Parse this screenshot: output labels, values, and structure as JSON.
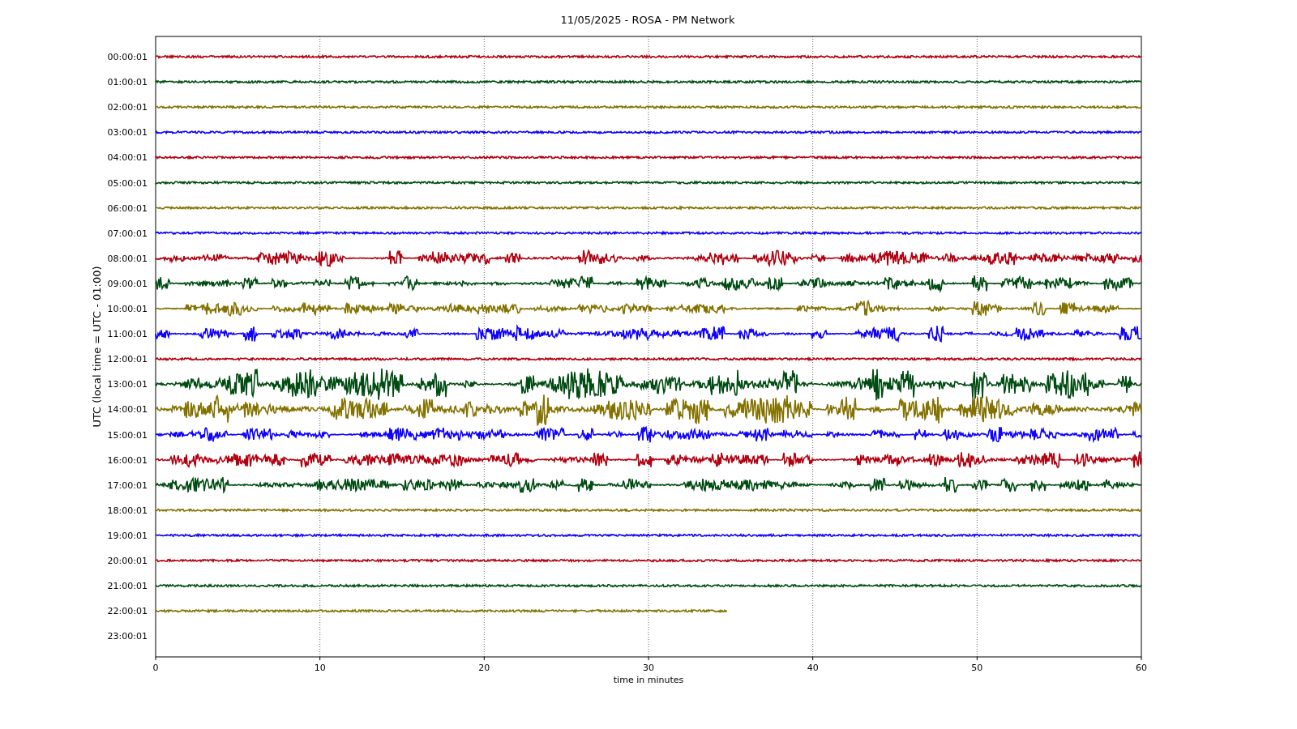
{
  "title": "11/05/2025 - ROSA - PM Network",
  "ylabel": "UTC (local time = UTC - 01:00)",
  "xlabel": "time in minutes",
  "xticks": [
    "0",
    "10",
    "20",
    "30",
    "40",
    "50",
    "60"
  ],
  "rows": [
    {
      "label": "00:00:01",
      "color": "#b2000f",
      "kind": "quiet",
      "level": 1
    },
    {
      "label": "01:00:01",
      "color": "#004c12",
      "kind": "quiet",
      "level": 1
    },
    {
      "label": "02:00:01",
      "color": "#847200",
      "kind": "quiet",
      "level": 1
    },
    {
      "label": "03:00:01",
      "color": "#0e01ff",
      "kind": "quiet",
      "level": 1
    },
    {
      "label": "04:00:01",
      "color": "#b2000f",
      "kind": "quiet",
      "level": 1
    },
    {
      "label": "05:00:01",
      "color": "#004c12",
      "kind": "quiet",
      "level": 1
    },
    {
      "label": "06:00:01",
      "color": "#847200",
      "kind": "quiet",
      "level": 1
    },
    {
      "label": "07:00:01",
      "color": "#0e01ff",
      "kind": "quiet",
      "level": 1
    },
    {
      "label": "08:00:01",
      "color": "#b2000f",
      "kind": "noisy",
      "level": 1
    },
    {
      "label": "09:00:01",
      "color": "#004c12",
      "kind": "noisy",
      "level": 1
    },
    {
      "label": "10:00:01",
      "color": "#847200",
      "kind": "noisy",
      "level": 1
    },
    {
      "label": "11:00:01",
      "color": "#0e01ff",
      "kind": "noisy",
      "level": 1
    },
    {
      "label": "12:00:01",
      "color": "#b2000f",
      "kind": "quiet",
      "level": 1
    },
    {
      "label": "13:00:01",
      "color": "#004c12",
      "kind": "strong",
      "level": 1
    },
    {
      "label": "14:00:01",
      "color": "#847200",
      "kind": "strong",
      "level": 1
    },
    {
      "label": "15:00:01",
      "color": "#0e01ff",
      "kind": "noisy",
      "level": 1
    },
    {
      "label": "16:00:01",
      "color": "#b2000f",
      "kind": "noisy",
      "level": 1
    },
    {
      "label": "17:00:01",
      "color": "#004c12",
      "kind": "noisy",
      "level": 1
    },
    {
      "label": "18:00:01",
      "color": "#847200",
      "kind": "quiet",
      "level": 1
    },
    {
      "label": "19:00:01",
      "color": "#0e01ff",
      "kind": "quiet",
      "level": 1
    },
    {
      "label": "20:00:01",
      "color": "#b2000f",
      "kind": "quiet",
      "level": 1
    },
    {
      "label": "21:00:01",
      "color": "#004c12",
      "kind": "quiet",
      "level": 1
    },
    {
      "label": "22:00:01",
      "color": "#847200",
      "kind": "quiet",
      "level": 0.58
    },
    {
      "label": "23:00:01"
    }
  ]
}
